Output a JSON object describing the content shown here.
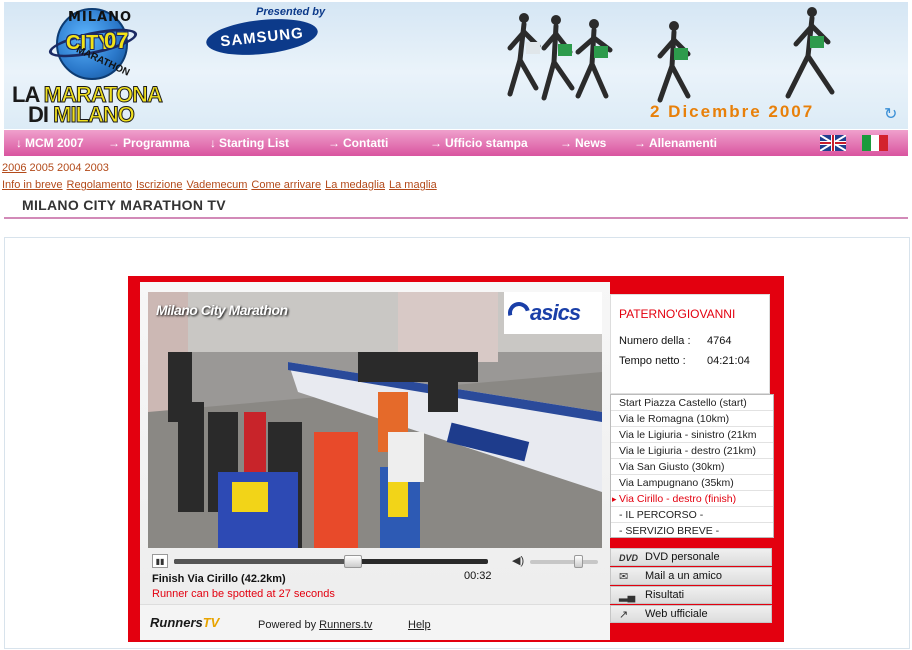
{
  "header": {
    "logo": {
      "milano": "MILANO",
      "city": "CITY",
      "year": "07",
      "marathon": "MARATHON"
    },
    "title_line1": "LA MARATONA",
    "title_line2": "DI MILANO",
    "presented_by": "Presented by",
    "sponsor": "SAMSUNG",
    "race_date": "2 Dicembre 2007",
    "refresh_icon": "refresh-icon"
  },
  "nav": {
    "items": [
      {
        "label": "MCM 2007",
        "arrow": "↓"
      },
      {
        "label": "Programma",
        "arrow": "→"
      },
      {
        "label": "Starting List",
        "arrow": "↓"
      },
      {
        "label": "Contatti",
        "arrow": "→"
      },
      {
        "label": "Ufficio stampa",
        "arrow": "→"
      },
      {
        "label": "News",
        "arrow": "→"
      },
      {
        "label": "Allenamenti",
        "arrow": "→"
      }
    ],
    "languages": [
      "uk-flag-icon",
      "italy-flag-icon"
    ]
  },
  "years": [
    "2006",
    "2005",
    "2004",
    "2003"
  ],
  "info_links": [
    "Info in breve",
    "Regolamento",
    "Iscrizione",
    "Vademecum",
    "Come arrivare",
    "La medaglia",
    "La maglia"
  ],
  "section_title": "MILANO CITY MARATHON TV",
  "player": {
    "overlay_title": "Milano City Marathon",
    "brand": "asics",
    "clip_title": "Finish Via Cirillo (42.2km)",
    "clip_time": "00:32",
    "clip_note": "Runner can be spotted at 27 seconds",
    "progress": 0.57,
    "volume": 0.7,
    "footer": {
      "logo_main": "Runners",
      "logo_tv": "TV",
      "powered_by": "Powered by",
      "powered_link": "Runners.tv",
      "help": "Help"
    }
  },
  "runner": {
    "name": "PATERNO'GIOVANNI",
    "number_label": "Numero della  :",
    "number": "4764",
    "net_time_label": "Tempo netto   :",
    "net_time": "04:21:04"
  },
  "splits": [
    {
      "label": "Start Piazza Castello (start)",
      "active": false
    },
    {
      "label": "Via le Romagna (10km)",
      "active": false
    },
    {
      "label": "Via le Ligiuria - sinistro (21km",
      "active": false
    },
    {
      "label": "Via le Ligiuria - destro (21km)",
      "active": false
    },
    {
      "label": "Via San Giusto (30km)",
      "active": false
    },
    {
      "label": "Via Lampugnano (35km)",
      "active": false
    },
    {
      "label": "Via Cirillo - destro (finish)",
      "active": true
    },
    {
      "label": "- IL PERCORSO -",
      "active": false
    },
    {
      "label": "- SERVIZIO BREVE -",
      "active": false
    }
  ],
  "actions": [
    {
      "label": "DVD personale",
      "icon": "DVD"
    },
    {
      "label": "Mail a un amico",
      "icon": "✉"
    },
    {
      "label": "Risultati",
      "icon": "▂▄"
    },
    {
      "label": "Web ufficiale",
      "icon": "↗"
    }
  ]
}
